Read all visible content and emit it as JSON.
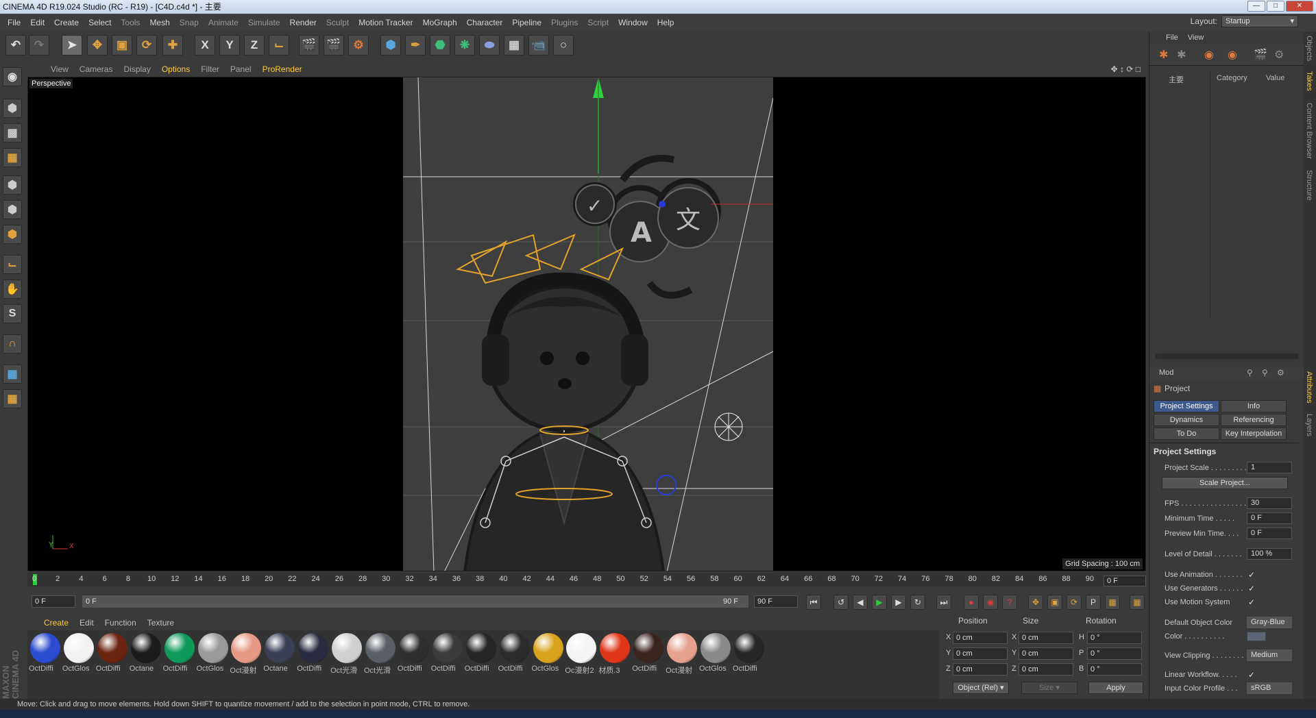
{
  "window": {
    "title": "CINEMA 4D R19.024 Studio (RC - R19) - [C4D.c4d *] - 主要"
  },
  "menu": [
    "File",
    "Edit",
    "Create",
    "Select",
    "Tools",
    "Mesh",
    "Snap",
    "Animate",
    "Simulate",
    "Render",
    "Sculpt",
    "Motion Tracker",
    "MoGraph",
    "Character",
    "Pipeline",
    "Plugins",
    "Script",
    "Window",
    "Help"
  ],
  "layout": {
    "label": "Layout:",
    "value": "Startup"
  },
  "toolbar_icons": [
    "undo-icon",
    "redo-icon",
    "live-selection-icon",
    "move-icon",
    "scale-icon",
    "rotate-icon",
    "move-axis-icon",
    "x-axis-icon",
    "y-axis-icon",
    "z-axis-icon",
    "world-coordinate-icon",
    "render-view-icon",
    "render-picture-viewer-icon",
    "edit-render-settings-icon",
    "cube-icon",
    "pen-icon",
    "subdivision-icon",
    "cloner-icon",
    "deformer-icon",
    "floor-icon",
    "camera-icon",
    "light-icon"
  ],
  "toolbar_xyz": [
    "X",
    "Y",
    "Z"
  ],
  "viewport": {
    "menu": [
      "View",
      "Cameras",
      "Display",
      "Options",
      "Filter",
      "Panel",
      "ProRender"
    ],
    "active_menu": "Options",
    "label": "Perspective",
    "grid_spacing": "Grid Spacing : 100 cm",
    "axis_y": "Y",
    "axis_x": "X"
  },
  "timeline": {
    "ticks": [
      "0",
      "2",
      "4",
      "6",
      "8",
      "10",
      "12",
      "14",
      "16",
      "18",
      "20",
      "22",
      "24",
      "26",
      "28",
      "30",
      "32",
      "34",
      "36",
      "38",
      "40",
      "42",
      "44",
      "46",
      "48",
      "50",
      "52",
      "54",
      "56",
      "58",
      "60",
      "62",
      "64",
      "66",
      "68",
      "70",
      "72",
      "74",
      "76",
      "78",
      "80",
      "82",
      "84",
      "86",
      "88",
      "90"
    ],
    "current_frame": "0 F",
    "start": "0 F",
    "range_start": "0 F",
    "range_end": "90 F",
    "end": "90 F"
  },
  "materials": {
    "menu": [
      "Create",
      "Edit",
      "Function",
      "Texture"
    ],
    "active_menu": "Create",
    "items": [
      {
        "name": "OctDiffi",
        "color": "#2b4bd1"
      },
      {
        "name": "OctGlos",
        "color": "#f2f2f2"
      },
      {
        "name": "OctDiffi",
        "color": "#6b2410"
      },
      {
        "name": "Octane",
        "color": "#1c1c1c"
      },
      {
        "name": "OctDiffi",
        "color": "#0f9a5c"
      },
      {
        "name": "OctGlos",
        "color": "#9a9a9a"
      },
      {
        "name": "Oct漫射",
        "color": "#e69a86"
      },
      {
        "name": "Octane",
        "color": "#3a3f55"
      },
      {
        "name": "OctDiffi",
        "color": "#2a2d40"
      },
      {
        "name": "Oct光滑",
        "color": "#cfcfcf"
      },
      {
        "name": "Oct光滑",
        "color": "#5a5f66"
      },
      {
        "name": "OctDiffi",
        "color": "#2f2f2f"
      },
      {
        "name": "OctDiffi",
        "color": "#3b3b3b"
      },
      {
        "name": "OctDiffi",
        "color": "#262626"
      },
      {
        "name": "OctDiffi",
        "color": "#2b2b2b"
      },
      {
        "name": "OctGlos",
        "color": "#d9a21c"
      },
      {
        "name": "Oc漫射2",
        "color": "#f4f4f4"
      },
      {
        "name": "材质.3",
        "color": "#e0361a"
      },
      {
        "name": "OctDiffi",
        "color": "#3a2420"
      },
      {
        "name": "Oct漫射",
        "color": "#e6a08e"
      },
      {
        "name": "OctGlos",
        "color": "#8a8a8a"
      },
      {
        "name": "OctDiffi",
        "color": "#262626"
      }
    ]
  },
  "coordinates": {
    "headers": [
      "Position",
      "Size",
      "Rotation"
    ],
    "rows": [
      {
        "pl": "X",
        "pv": "0 cm",
        "sl": "X",
        "sv": "0 cm",
        "rl": "H",
        "rv": "0 °"
      },
      {
        "pl": "Y",
        "pv": "0 cm",
        "sl": "Y",
        "sv": "0 cm",
        "rl": "P",
        "rv": "0 °"
      },
      {
        "pl": "Z",
        "pv": "0 cm",
        "sl": "Z",
        "sv": "0 cm",
        "rl": "B",
        "rv": "0 °"
      }
    ],
    "mode": "Object (Rel)",
    "size_mode": "Size",
    "apply": "Apply"
  },
  "objects_panel": {
    "menu": [
      "File",
      "View"
    ],
    "columns": [
      "主要",
      "Category",
      "Value"
    ]
  },
  "attributes": {
    "mode": "Mod",
    "title": "Project",
    "tabs": [
      "Project Settings",
      "Info",
      "Dynamics",
      "Referencing",
      "To Do",
      "Key Interpolation"
    ],
    "active_tab": "Project Settings",
    "section": "Project Settings",
    "fields": [
      {
        "label": "Project Scale . . . . . . . . .",
        "value": "1"
      },
      {
        "label": "FPS . . . . . . . . . . . . . . . . . . .",
        "value": "30"
      },
      {
        "label": "Minimum Time . . . . .",
        "value": "0 F"
      },
      {
        "label": "Preview Min Time. . . .",
        "value": "0 F"
      },
      {
        "label": "Level of Detail . . . . . . .",
        "value": "100 %"
      }
    ],
    "scale_button": "Scale Project...",
    "checks": [
      {
        "label": "Use Animation . . . . . . .",
        "value": "✓"
      },
      {
        "label": "Use Generators . . . . . .",
        "value": "✓"
      },
      {
        "label": "Use Motion System",
        "value": "✓"
      }
    ],
    "default_color_label": "Default Object Color",
    "default_color_value": "Gray-Blue",
    "color_label": "Color . . . . . . . . . .",
    "view_clipping_label": "View Clipping . . . . . . . .",
    "view_clipping_value": "Medium",
    "linear_workflow_label": "Linear Workflow. . . . .",
    "linear_workflow_value": "✓",
    "input_color_label": "Input Color Profile . . .",
    "input_color_value": "sRGB"
  },
  "side_tabs": [
    "Objects",
    "Takes",
    "Content Browser",
    "Structure",
    "Attributes",
    "Layers"
  ],
  "status": "Move: Click and drag to move elements. Hold down SHIFT to quantize movement / add to the selection in point mode, CTRL to remove.",
  "maxon_logo": "MAXON CINEMA 4D"
}
